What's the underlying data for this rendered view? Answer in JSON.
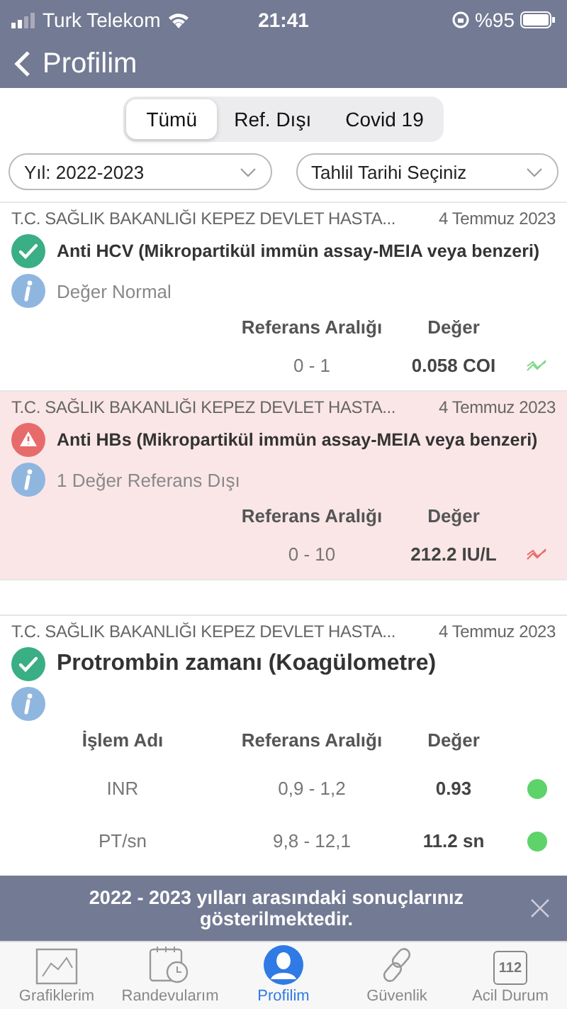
{
  "status_bar": {
    "carrier": "Turk Telekom",
    "time": "21:41",
    "battery": "%95"
  },
  "nav": {
    "back_label": "Profilim"
  },
  "tabs": [
    {
      "label": "Tümü",
      "selected": true
    },
    {
      "label": "Ref. Dışı",
      "selected": false
    },
    {
      "label": "Covid 19",
      "selected": false
    }
  ],
  "filters": [
    {
      "label": "Yıl: 2022-2023"
    },
    {
      "label": "Tahlil Tarihi Seçiniz"
    }
  ],
  "results": [
    {
      "kind": "single",
      "out_of_range": false,
      "source": "T.C. SAĞLIK BAKANLIĞI KEPEZ DEVLET HASTA...",
      "date": "4 Temmuz 2023",
      "test": "Anti HCV (Mikropartikül immün assay-MEIA veya benzeri)",
      "note": "Değer Normal",
      "columns": [
        "Referans Aralığı",
        "Değer"
      ],
      "rows": [
        {
          "reference": "0 - 1",
          "value": "0.058 COI",
          "kind": "trend"
        }
      ]
    },
    {
      "kind": "single",
      "out_of_range": true,
      "source": "T.C. SAĞLIK BAKANLIĞI KEPEZ DEVLET HASTA...",
      "date": "4 Temmuz 2023",
      "test": "Anti HBs  (Mikropartikül immün assay-MEIA veya benzeri)",
      "note": "1 Değer Referans Dışı",
      "columns": [
        "Referans Aralığı",
        "Değer"
      ],
      "rows": [
        {
          "reference": "0 - 10",
          "value": "212.2 IU/L",
          "kind": "trend"
        }
      ]
    },
    {
      "kind": "panel",
      "out_of_range": false,
      "source": "T.C. SAĞLIK BAKANLIĞI KEPEZ DEVLET HASTA...",
      "date": "4 Temmuz 2023",
      "test": "Protrombin zamanı (Koagülometre)",
      "columns": [
        "İşlem Adı",
        "Referans Aralığı",
        "Değer"
      ],
      "rows": [
        {
          "name": "INR",
          "reference": "0,9 - 1,2",
          "value": "0.93",
          "kind": "dot"
        },
        {
          "name": "PT/sn",
          "reference": "9,8 - 12,1",
          "value": "11.2 sn",
          "kind": "dot"
        }
      ]
    }
  ],
  "banner": {
    "text": "2022 - 2023 yılları arasındaki sonuçlarınız gösterilmektedir."
  },
  "tab_bar": [
    {
      "kind": "charts",
      "label": "Grafiklerim",
      "selected": false
    },
    {
      "kind": "appointments",
      "label": "Randevularım",
      "selected": false
    },
    {
      "kind": "profile",
      "label": "Profilim",
      "selected": true
    },
    {
      "kind": "security",
      "label": "Güvenlik",
      "selected": false
    },
    {
      "kind": "emergency",
      "label": "Acil Durum",
      "icon_text": "112",
      "selected": false
    }
  ]
}
